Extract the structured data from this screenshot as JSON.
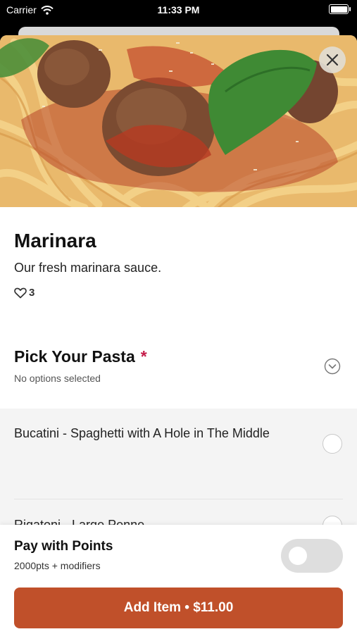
{
  "status_bar": {
    "carrier": "Carrier",
    "time": "11:33 PM"
  },
  "hero": {
    "image": "spaghetti-and-meatballs-photo",
    "close_icon": "close-icon"
  },
  "item": {
    "title": "Marinara",
    "description": "Our fresh marinara sauce.",
    "likes": "3",
    "like_icon": "heart-icon"
  },
  "group": {
    "title": "Pick Your Pasta",
    "required_mark": "*",
    "subtitle": "No options selected",
    "expand_icon": "chevron-down-circle-icon",
    "options": [
      {
        "label": "Bucatini - Spaghetti with A Hole in The Middle",
        "selected": false
      },
      {
        "label": "Rigatoni - Large Penne",
        "selected": false
      }
    ]
  },
  "footer": {
    "points_title": "Pay with Points",
    "points_subtitle": "2000pts + modifiers",
    "points_toggle_on": false,
    "add_button_label": "Add Item • $11.00"
  },
  "colors": {
    "accent": "#c0502a",
    "required": "#c51d4a",
    "toggle_off": "#dedede"
  }
}
